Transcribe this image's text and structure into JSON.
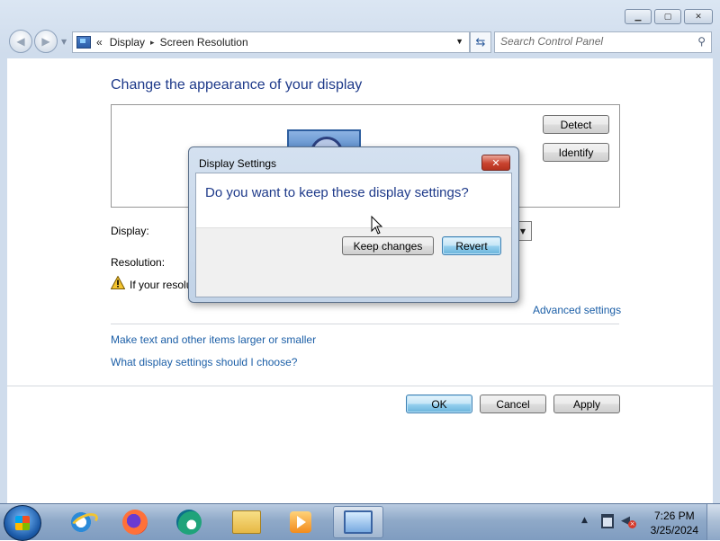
{
  "window": {
    "caption_buttons": [
      "minimize-icon",
      "maximize-icon",
      "close-icon"
    ]
  },
  "address_bar": {
    "chevron": "«",
    "crumbs": [
      "Display",
      "Screen Resolution"
    ],
    "separator": "▸"
  },
  "search": {
    "placeholder": "Search Control Panel"
  },
  "page": {
    "heading": "Change the appearance of your display",
    "detect_button": "Detect",
    "identify_button": "Identify",
    "display_label": "Display:",
    "resolution_label": "Resolution:",
    "warning_text_visible": "If your resolu",
    "advanced_link": "Advanced settings",
    "text_size_link": "Make text and other items larger or smaller",
    "help_link": "What display settings should I choose?",
    "ok_button": "OK",
    "cancel_button": "Cancel",
    "apply_button": "Apply"
  },
  "dialog": {
    "title": "Display Settings",
    "question": "Do you want to keep these display settings?",
    "keep_button": "Keep changes",
    "revert_button": "Revert",
    "close_glyph": "✕"
  },
  "taskbar": {
    "pinned": [
      "internet-explorer-icon",
      "firefox-icon",
      "edge-icon",
      "file-explorer-icon",
      "media-player-icon",
      "display-settings-icon"
    ],
    "clock_time": "7:26 PM",
    "clock_date": "3/25/2024"
  }
}
